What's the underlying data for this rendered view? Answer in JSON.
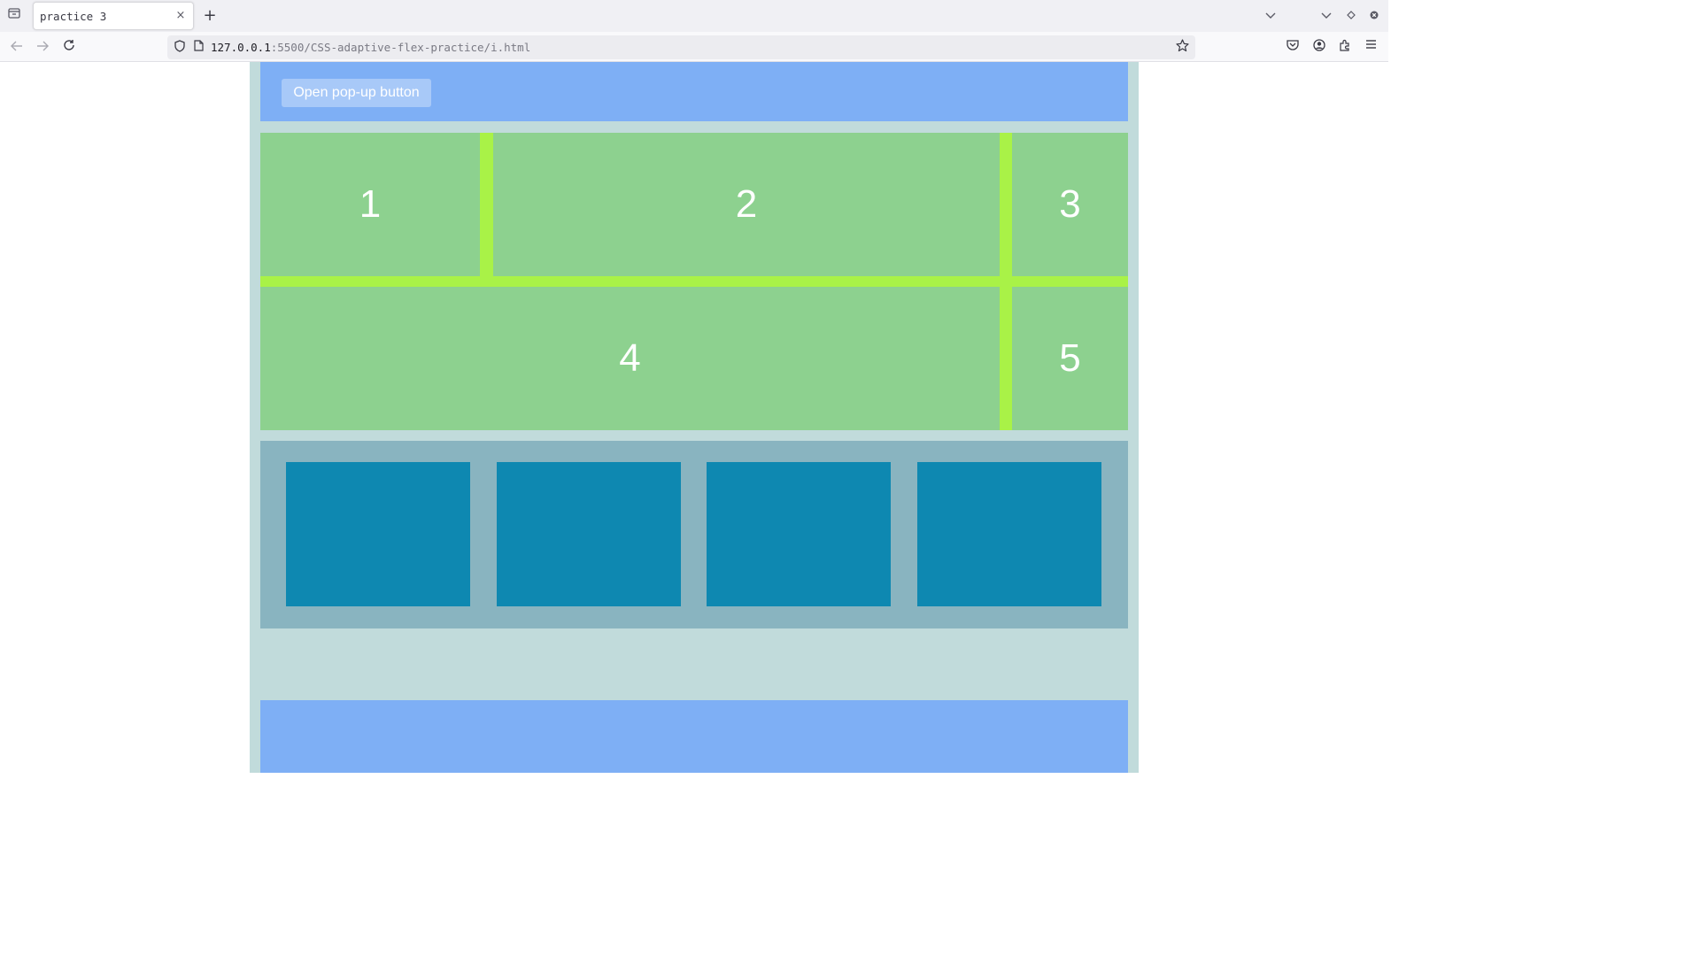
{
  "browser": {
    "tab": {
      "title": "practice 3",
      "close_icon": "×"
    },
    "new_tab_icon": "+",
    "url": {
      "host": "127.0.0.1",
      "rest": ":5500/CSS-adaptive-flex-practice/i.html"
    }
  },
  "page": {
    "header": {
      "popup_button_label": "Open pop-up button"
    },
    "grid": {
      "cells": [
        "1",
        "2",
        "3",
        "4",
        "5"
      ]
    },
    "cards": {
      "count": 4
    }
  },
  "colors": {
    "header_blue": "#7eaff5",
    "popup_button": "#a8c9f8",
    "wrapper_bg": "#c1dbdb",
    "grid_gap_lime": "#a9f247",
    "cell_green": "#8dd18f",
    "cards_bg": "#89b4c0",
    "card_teal": "#0e88b1"
  },
  "icons": {
    "tab_list": "tab-list-icon",
    "back": "back-arrow-icon",
    "forward": "forward-arrow-icon",
    "reload": "reload-icon",
    "shield": "tracking-shield-icon",
    "page": "page-info-icon",
    "bookmark": "bookmark-star-icon",
    "pocket": "pocket-icon",
    "account": "account-icon",
    "extensions": "extensions-icon",
    "menu": "hamburger-menu-icon"
  }
}
